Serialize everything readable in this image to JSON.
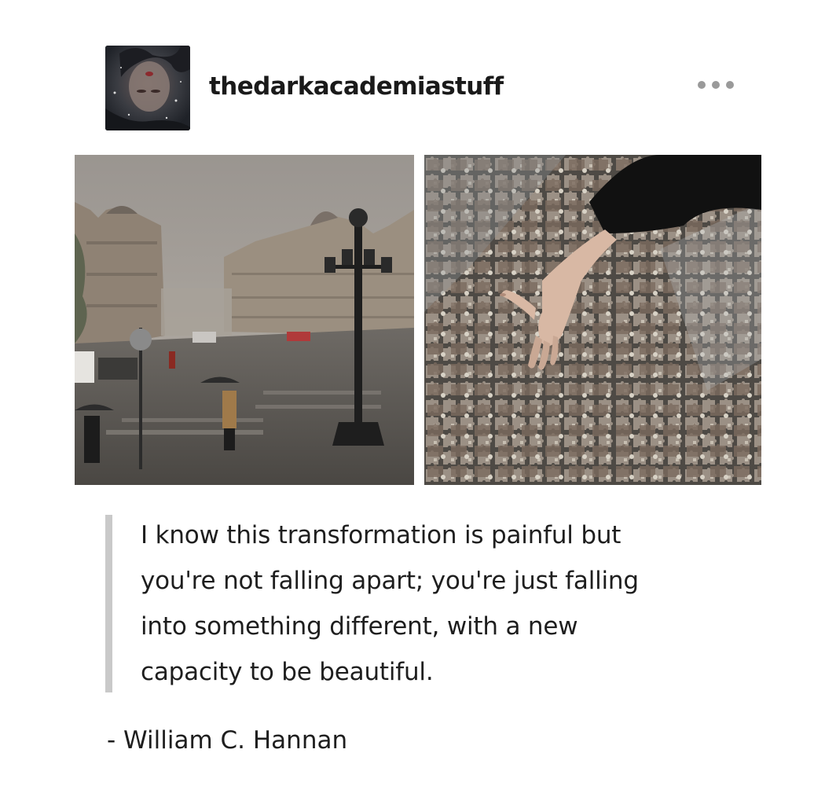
{
  "post": {
    "username": "thedarkacademiastuff",
    "more_icon": "ellipsis-icon",
    "avatar_icon": "avatar",
    "photos": [
      {
        "name": "rainy-paris-street-photo"
      },
      {
        "name": "jigsaw-puzzle-pieces-photo"
      }
    ],
    "quote_lines": [
      "I know this transformation is painful but",
      "you're not falling apart; you're just falling",
      "into something different, with a new",
      "capacity to be beautiful."
    ],
    "attribution": "- William C. Hannan"
  },
  "colors": {
    "background": "#ffffff",
    "text": "#1e1e1e",
    "quote_bar": "#c9c9c9",
    "ellipsis": "#9a9a9a"
  }
}
